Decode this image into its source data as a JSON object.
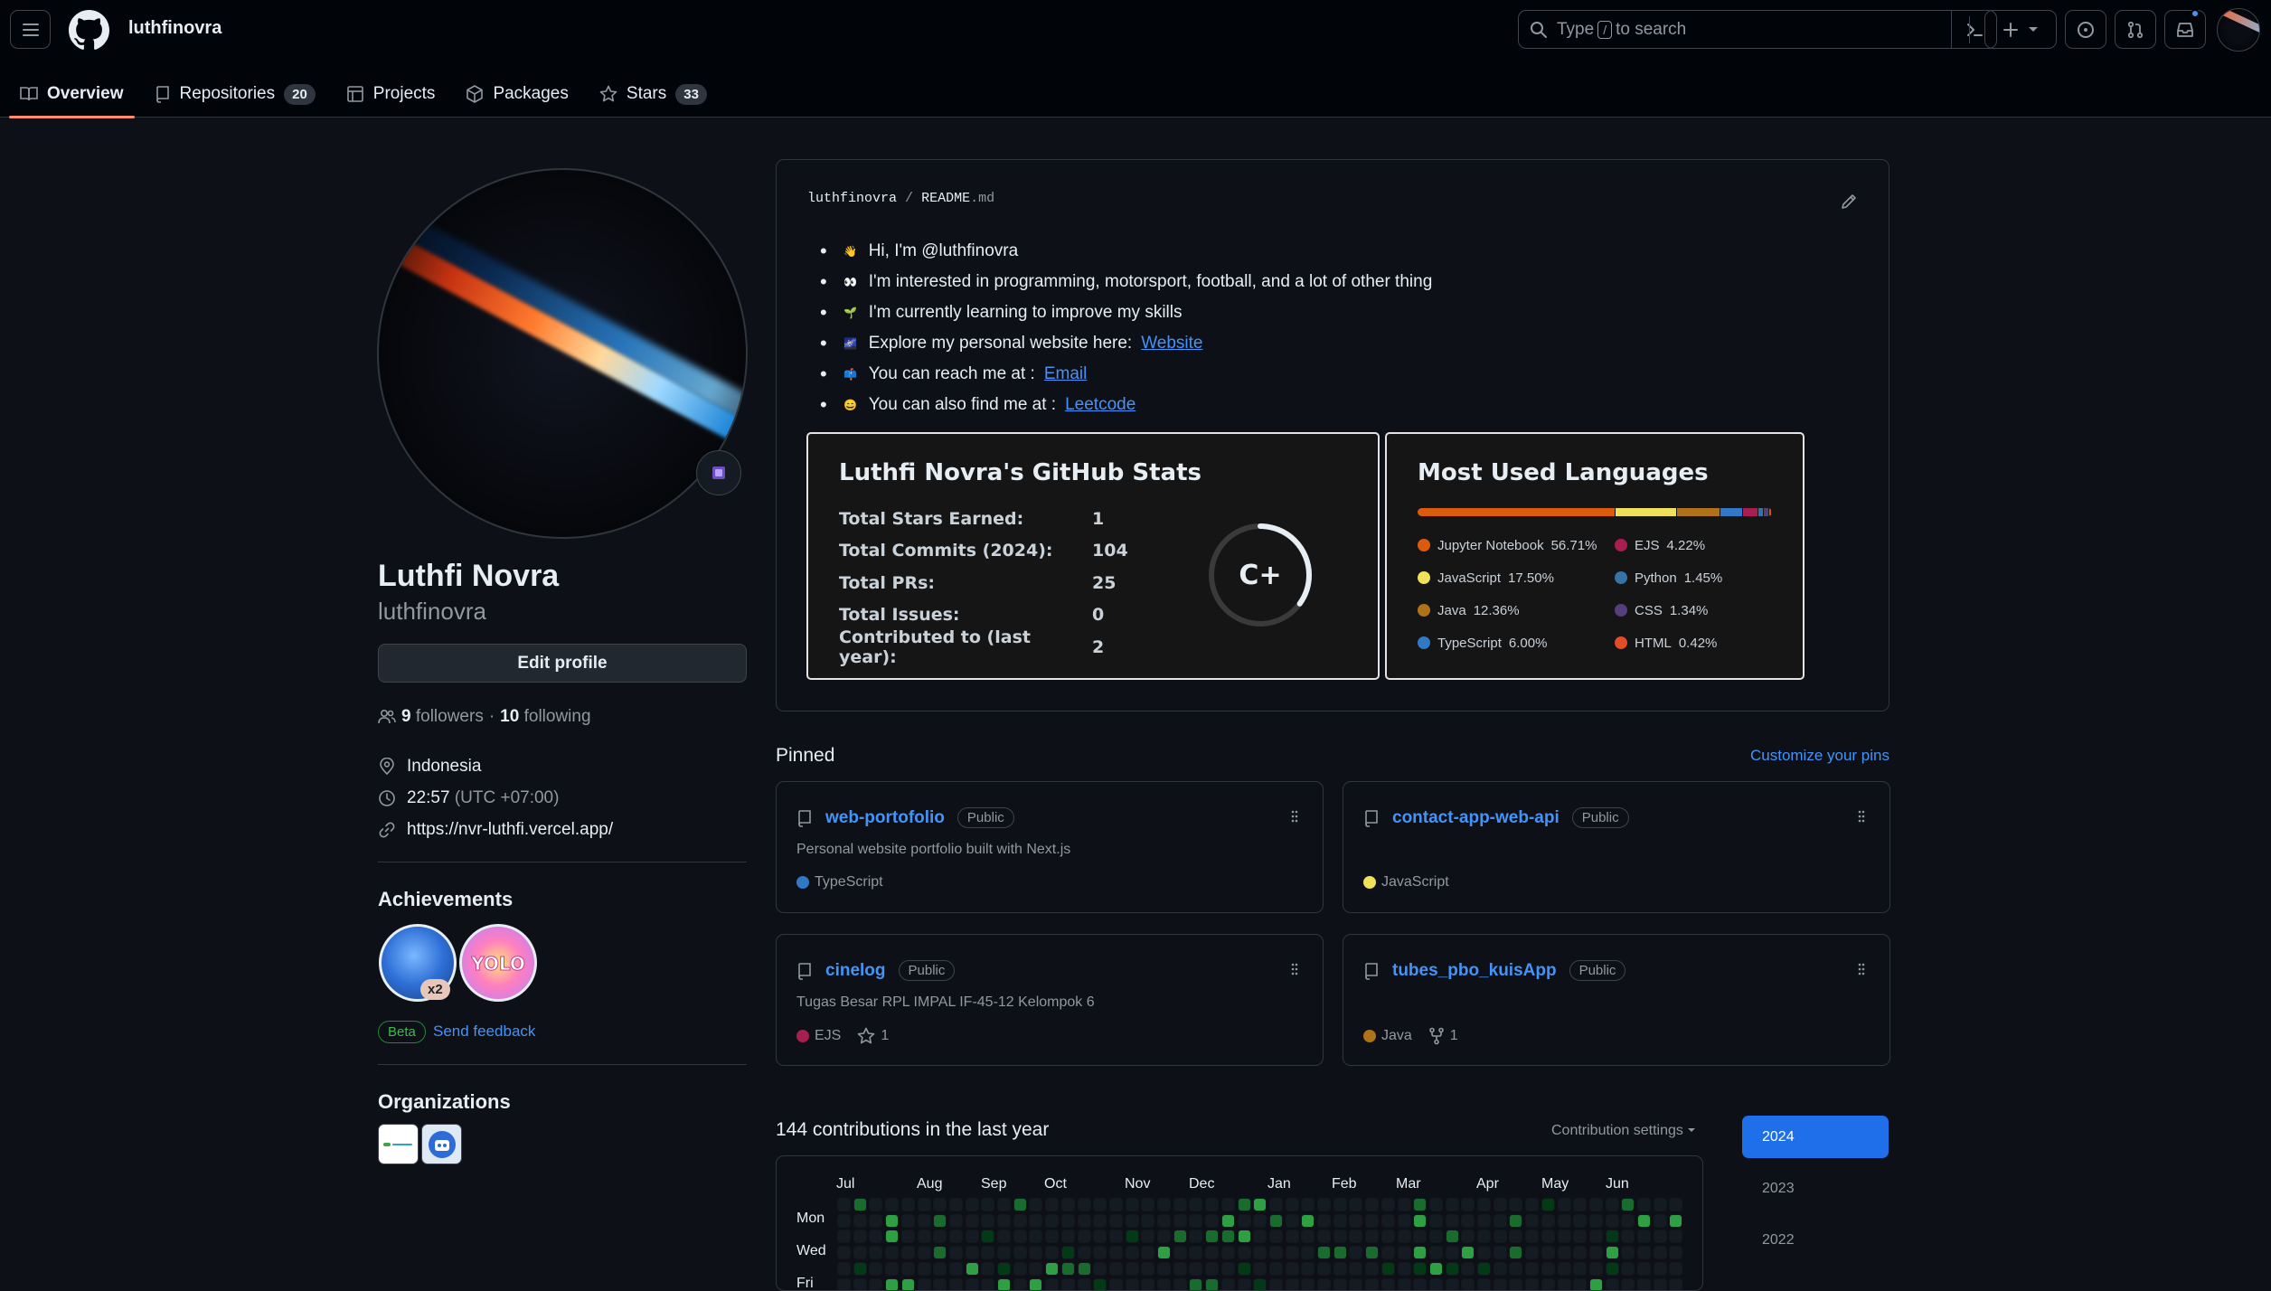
{
  "header": {
    "username": "luthfinovra",
    "search_prefix": "Type",
    "search_key": "/",
    "search_suffix": "to search"
  },
  "tabs": [
    {
      "label": "Overview",
      "count": null
    },
    {
      "label": "Repositories",
      "count": "20"
    },
    {
      "label": "Projects",
      "count": null
    },
    {
      "label": "Packages",
      "count": null
    },
    {
      "label": "Stars",
      "count": "33"
    }
  ],
  "profile": {
    "name": "Luthfi Novra",
    "login": "luthfinovra",
    "edit_label": "Edit profile",
    "followers_count": "9",
    "followers_label": "followers",
    "separator": "·",
    "following_count": "10",
    "following_label": "following",
    "location": "Indonesia",
    "time": "22:57",
    "timezone": "(UTC +07:00)",
    "website": "https://nvr-luthfi.vercel.app/"
  },
  "achievements": {
    "title": "Achievements",
    "multiplier": "x2",
    "beta": "Beta",
    "feedback": "Send feedback"
  },
  "organizations": {
    "title": "Organizations"
  },
  "readme": {
    "owner": "luthfinovra",
    "slash": "/",
    "file": "README",
    "ext": ".md",
    "lines": [
      {
        "emoji": "👋",
        "text": "Hi, I'm @luthfinovra",
        "link": ""
      },
      {
        "emoji": "👀",
        "text": "I'm interested in programming, motorsport, football, and a lot of other thing",
        "link": ""
      },
      {
        "emoji": "🌱",
        "text": "I'm currently learning to improve my skills",
        "link": ""
      },
      {
        "emoji": "🌌",
        "text": "Explore my personal website here:",
        "link": "Website"
      },
      {
        "emoji": "📫",
        "text": "You can reach me at :",
        "link": "Email"
      },
      {
        "emoji": "😄",
        "text": "You can also find me at :",
        "link": "Leetcode"
      }
    ]
  },
  "stats": {
    "title": "Luthfi Novra's GitHub Stats",
    "rows": [
      {
        "label": "Total Stars Earned:",
        "value": "1"
      },
      {
        "label": "Total Commits (2024):",
        "value": "104"
      },
      {
        "label": "Total PRs:",
        "value": "25"
      },
      {
        "label": "Total Issues:",
        "value": "0"
      },
      {
        "label": "Contributed to (last year):",
        "value": "2"
      }
    ],
    "grade": "C+",
    "grade_progress": 0.35
  },
  "languages": {
    "title": "Most Used Languages",
    "items": [
      {
        "name": "Jupyter Notebook",
        "pct": "56.71%",
        "value": 56.71,
        "color": "#DA5B0B"
      },
      {
        "name": "JavaScript",
        "pct": "17.50%",
        "value": 17.5,
        "color": "#f1e05a"
      },
      {
        "name": "Java",
        "pct": "12.36%",
        "value": 12.36,
        "color": "#b07219"
      },
      {
        "name": "TypeScript",
        "pct": "6.00%",
        "value": 6.0,
        "color": "#3178c6"
      },
      {
        "name": "EJS",
        "pct": "4.22%",
        "value": 4.22,
        "color": "#a91e50"
      },
      {
        "name": "Python",
        "pct": "1.45%",
        "value": 1.45,
        "color": "#3572A5"
      },
      {
        "name": "CSS",
        "pct": "1.34%",
        "value": 1.34,
        "color": "#563d7c"
      },
      {
        "name": "HTML",
        "pct": "0.42%",
        "value": 0.42,
        "color": "#e34c26"
      }
    ]
  },
  "pinned": {
    "title": "Pinned",
    "customize": "Customize your pins",
    "repos": [
      {
        "name": "web-portofolio",
        "visibility": "Public",
        "description": "Personal website portfolio built with Next.js",
        "language": "TypeScript",
        "lang_color": "#3178c6",
        "stars": "",
        "forks": ""
      },
      {
        "name": "contact-app-web-api",
        "visibility": "Public",
        "description": "",
        "language": "JavaScript",
        "lang_color": "#f1e05a",
        "stars": "",
        "forks": ""
      },
      {
        "name": "cinelog",
        "visibility": "Public",
        "description": "Tugas Besar RPL IMPAL IF-45-12 Kelompok 6",
        "language": "EJS",
        "lang_color": "#a91e50",
        "stars": "1",
        "forks": ""
      },
      {
        "name": "tubes_pbo_kuisApp",
        "visibility": "Public",
        "description": "",
        "language": "Java",
        "lang_color": "#b07219",
        "stars": "",
        "forks": "1"
      }
    ]
  },
  "contributions": {
    "title": "144 contributions in the last year",
    "settings": "Contribution settings",
    "months": [
      "Jul",
      "Aug",
      "Sep",
      "Oct",
      "Nov",
      "Dec",
      "Jan",
      "Feb",
      "Mar",
      "Apr",
      "May",
      "Jun"
    ],
    "day_labels": [
      "Mon",
      "Wed",
      "Fri"
    ],
    "years": [
      "2024",
      "2023",
      "2022"
    ]
  }
}
